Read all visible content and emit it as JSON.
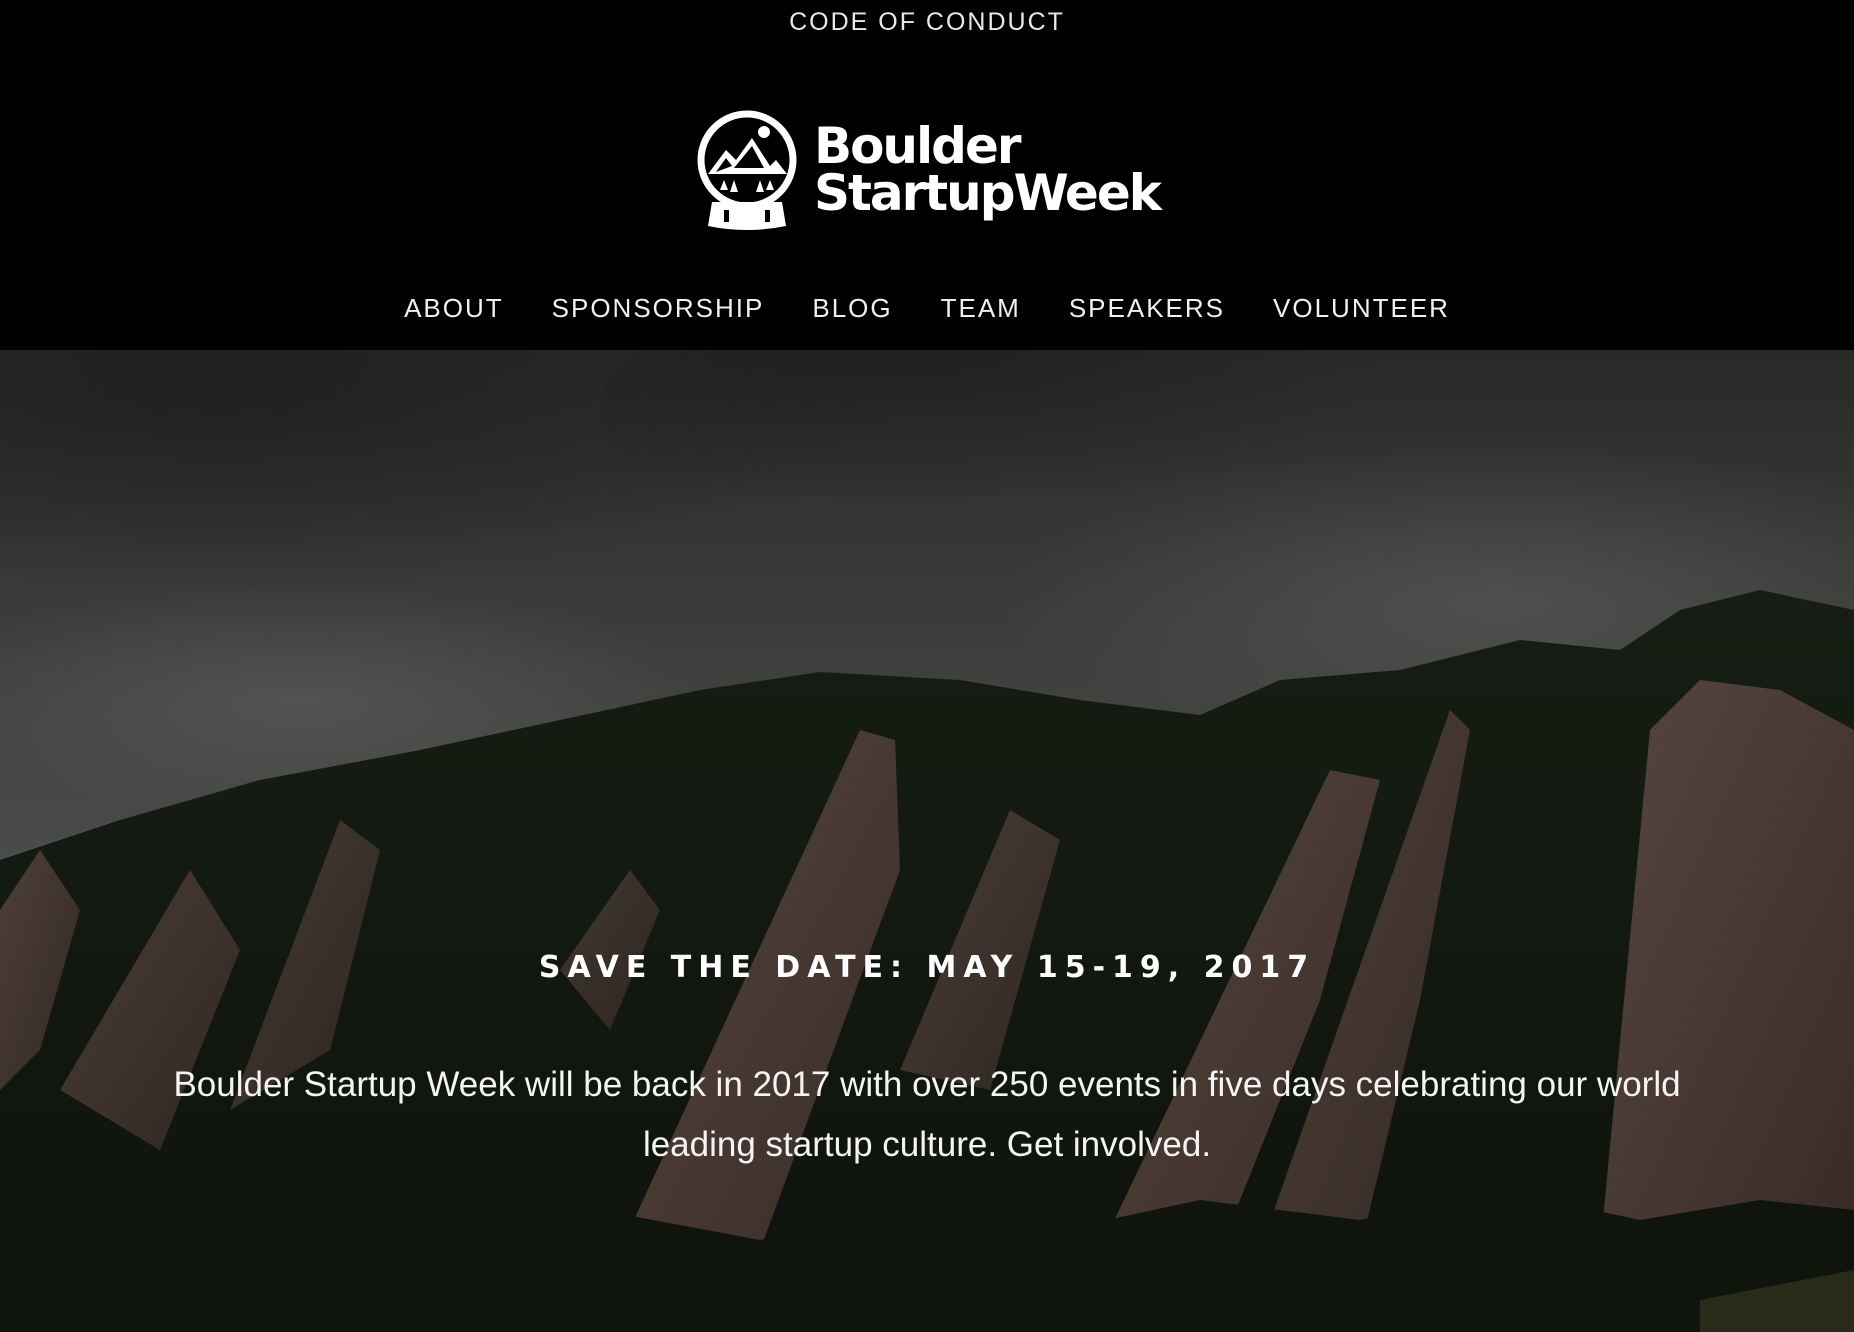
{
  "topbar": {
    "code_of_conduct": "CODE OF CONDUCT"
  },
  "brand": {
    "line1": "Boulder",
    "line2": "StartupWeek",
    "logo_icon": "snow-globe-mountains-icon"
  },
  "nav": {
    "items": [
      "ABOUT",
      "SPONSORSHIP",
      "BLOG",
      "TEAM",
      "SPEAKERS",
      "VOLUNTEER"
    ]
  },
  "hero": {
    "title": "SAVE THE DATE: MAY 15-19, 2017",
    "description": "Boulder Startup Week will be back in 2017 with over 250 events in five days celebrating our world leading startup culture. Get involved.",
    "background": "flatirons-mountains-photo"
  },
  "colors": {
    "header_bg": "#000000",
    "text": "#ffffff"
  }
}
